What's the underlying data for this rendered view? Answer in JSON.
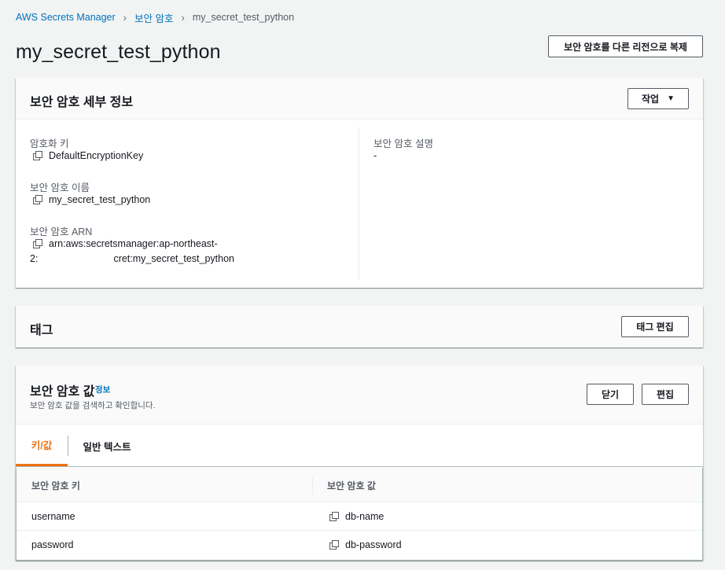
{
  "breadcrumb": {
    "root": "AWS Secrets Manager",
    "parent": "보안 암호",
    "current": "my_secret_test_python"
  },
  "page": {
    "title": "my_secret_test_python",
    "replicate_button": "보안 암호를 다른 리전으로 복제"
  },
  "details": {
    "title": "보안 암호 세부 정보",
    "actions_button": "작업",
    "encryption_key_label": "암호화 키",
    "encryption_key_value": "DefaultEncryptionKey",
    "secret_name_label": "보안 암호 이름",
    "secret_name_value": "my_secret_test_python",
    "arn_label": "보안 암호 ARN",
    "arn_line1": "arn:aws:secretsmanager:ap-northeast-",
    "arn_line2_prefix": "2:",
    "arn_line2_suffix": "cret:my_secret_test_python",
    "description_label": "보안 암호 설명",
    "description_value": "-"
  },
  "tags": {
    "title": "태그",
    "edit_button": "태그 편집"
  },
  "secret_value": {
    "title": "보안 암호 값",
    "info_link": "정보",
    "subtitle": "보안 암호 값을 검색하고 확인합니다.",
    "close_button": "닫기",
    "edit_button": "편집",
    "tabs": [
      {
        "label": "키/값",
        "active": true
      },
      {
        "label": "일반 텍스트",
        "active": false
      }
    ],
    "columns": [
      "보안 암호 키",
      "보안 암호 값"
    ],
    "rows": [
      {
        "key": "username",
        "value": "db-name"
      },
      {
        "key": "password",
        "value": "db-password"
      }
    ]
  },
  "colors": {
    "link": "#0073bb",
    "active_tab": "#ec7211",
    "background": "#f2f3f3"
  },
  "icons": [
    "chevron-right-icon",
    "copy-icon",
    "caret-down-icon"
  ]
}
